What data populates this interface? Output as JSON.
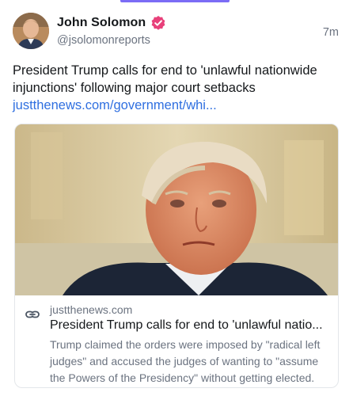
{
  "post": {
    "author": {
      "display_name": "John Solomon",
      "handle": "@jsolomonreports",
      "verified_icon": "verified-badge-icon",
      "verified_color": "#e8407a"
    },
    "time": "7m",
    "text": "President Trump calls for end to 'unlawful nationwide injunctions' following major court setbacks",
    "link_text": "justthenews.com/government/whi...",
    "link_color": "#2f6fe0"
  },
  "card": {
    "icon": "link-icon",
    "domain": "justthenews.com",
    "title": "President Trump calls for end to 'unlawful natio...",
    "description": "Trump claimed the orders were imposed by \"radical left judges\" and accused the judges of wanting to \"assume the Powers of the Presidency\" without getting elected."
  }
}
